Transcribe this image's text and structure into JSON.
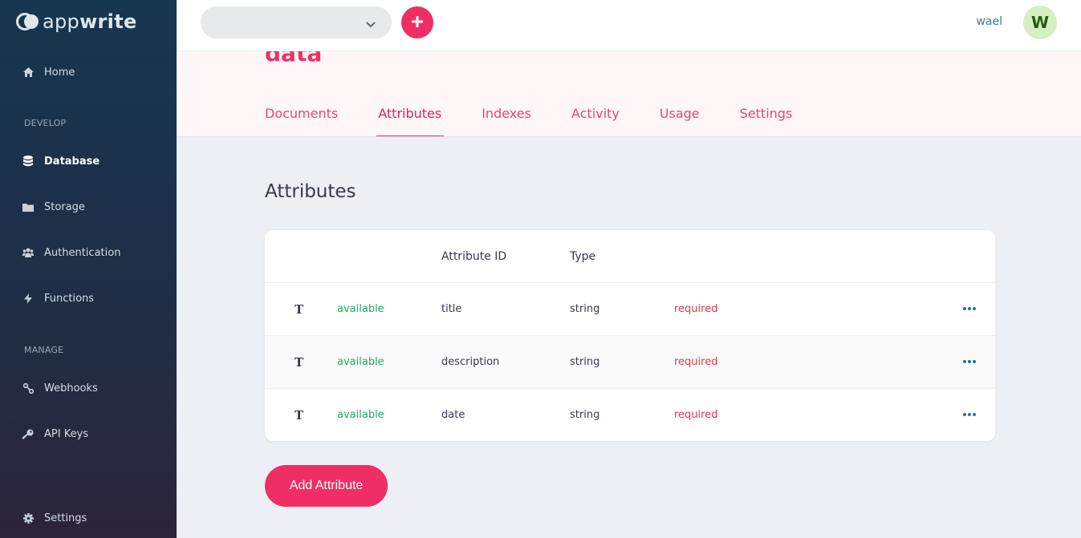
{
  "sidebar": {
    "logo_light": "app",
    "logo_bold": "write",
    "items": [
      {
        "label": "Home"
      },
      {
        "label": "Database"
      },
      {
        "label": "Storage"
      },
      {
        "label": "Authentication"
      },
      {
        "label": "Functions"
      },
      {
        "label": "Webhooks"
      },
      {
        "label": "API Keys"
      },
      {
        "label": "Settings"
      }
    ],
    "sections": {
      "develop": "DEVELOP",
      "manage": "MANAGE"
    }
  },
  "topbar": {
    "user_name": "wael",
    "avatar_initial": "W"
  },
  "header": {
    "collection_title": "data",
    "tabs": [
      {
        "label": "Documents"
      },
      {
        "label": "Attributes"
      },
      {
        "label": "Indexes"
      },
      {
        "label": "Activity"
      },
      {
        "label": "Usage"
      },
      {
        "label": "Settings"
      }
    ]
  },
  "main": {
    "section_title": "Attributes",
    "table": {
      "headers": {
        "attribute_id": "Attribute ID",
        "type": "Type"
      },
      "rows": [
        {
          "icon": "T",
          "status": "available",
          "id": "title",
          "type": "string",
          "required": "required"
        },
        {
          "icon": "T",
          "status": "available",
          "id": "description",
          "type": "string",
          "required": "required"
        },
        {
          "icon": "T",
          "status": "available",
          "id": "date",
          "type": "string",
          "required": "required"
        }
      ]
    },
    "add_button": "Add Attribute"
  },
  "colors": {
    "accent": "#f02e65",
    "available": "#1aae5e",
    "required": "#e2364b",
    "sidebar_top": "#17364f",
    "sidebar_bottom": "#2c2438"
  },
  "icons": {
    "home": "home-icon",
    "database": "database-icon",
    "storage": "folder-icon",
    "authentication": "users-icon",
    "functions": "lightning-icon",
    "webhooks": "link-icon",
    "api_keys": "key-icon",
    "settings": "gear-icon"
  }
}
